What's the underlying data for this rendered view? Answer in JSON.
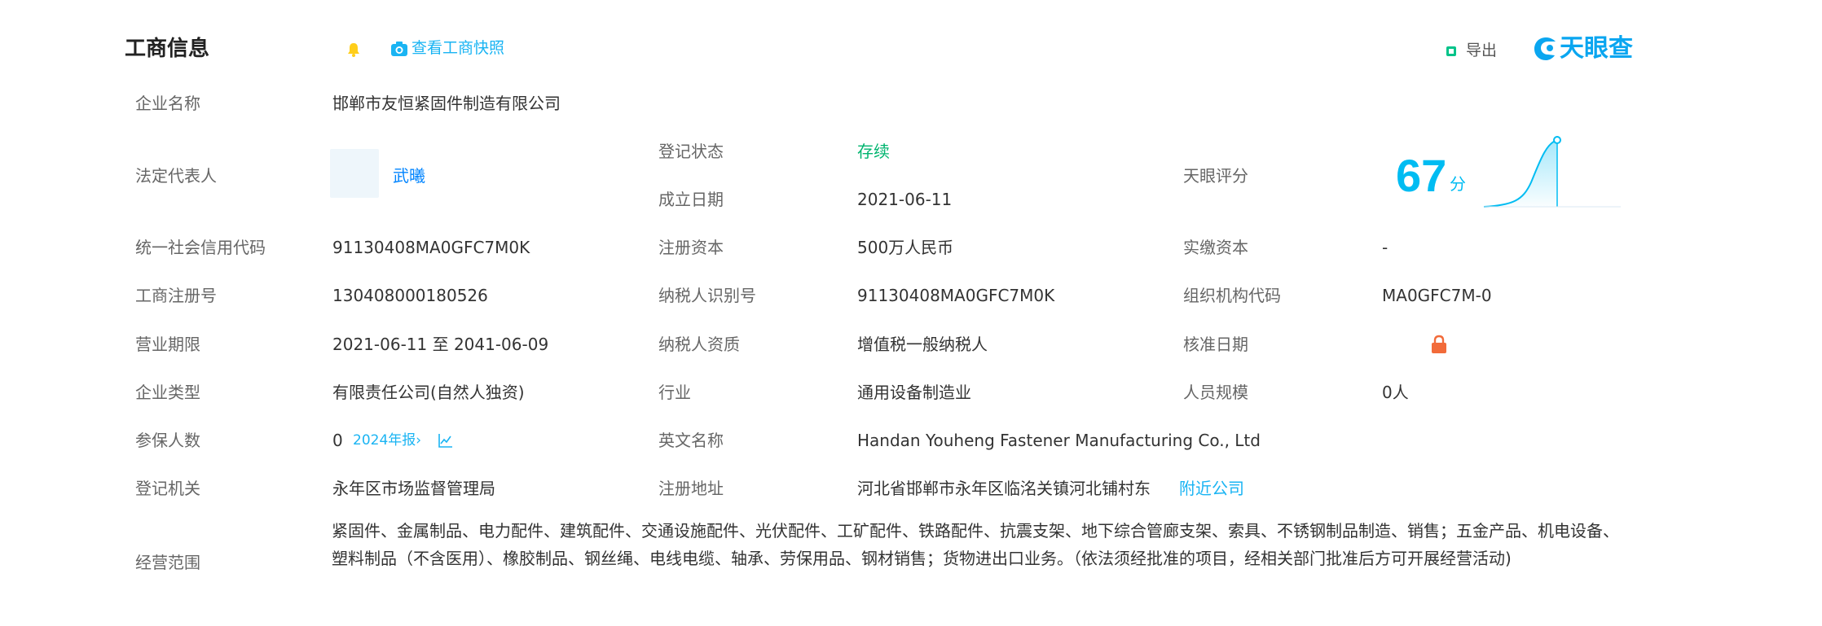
{
  "header": {
    "title": "工商信息",
    "snapshot_link": "查看工商快照",
    "export_label": "导出",
    "brand": "天眼查"
  },
  "rows": {
    "company_name": {
      "label": "企业名称",
      "value": "邯郸市友恒紧固件制造有限公司"
    },
    "legal_rep": {
      "label": "法定代表人",
      "value": "武曦"
    },
    "reg_status": {
      "label": "登记状态",
      "value": "存续"
    },
    "found_date": {
      "label": "成立日期",
      "value": "2021-06-11"
    },
    "tianyan_score": {
      "label": "天眼评分",
      "value": "67",
      "unit": "分"
    },
    "credit_code": {
      "label": "统一社会信用代码",
      "value": "91130408MA0GFC7M0K"
    },
    "reg_capital": {
      "label": "注册资本",
      "value": "500万人民币"
    },
    "paid_capital": {
      "label": "实缴资本",
      "value": "-"
    },
    "biz_reg_no": {
      "label": "工商注册号",
      "value": "130408000180526"
    },
    "taxpayer_id": {
      "label": "纳税人识别号",
      "value": "91130408MA0GFC7M0K"
    },
    "org_code": {
      "label": "组织机构代码",
      "value": "MA0GFC7M-0"
    },
    "biz_term": {
      "label": "营业期限",
      "value": "2021-06-11 至 2041-06-09"
    },
    "taxpayer_qual": {
      "label": "纳税人资质",
      "value": "增值税一般纳税人"
    },
    "approve_date": {
      "label": "核准日期"
    },
    "company_type": {
      "label": "企业类型",
      "value": "有限责任公司(自然人独资)"
    },
    "industry": {
      "label": "行业",
      "value": "通用设备制造业"
    },
    "staff_size": {
      "label": "人员规模",
      "value": "0人"
    },
    "insured": {
      "label": "参保人数",
      "value": "0",
      "report_link": "2024年报›"
    },
    "english_name": {
      "label": "英文名称",
      "value": "Handan Youheng Fastener Manufacturing Co., Ltd"
    },
    "reg_authority": {
      "label": "登记机关",
      "value": "永年区市场监督管理局"
    },
    "reg_address": {
      "label": "注册地址",
      "value": "河北省邯郸市永年区临洺关镇河北铺村东",
      "nearby_link": "附近公司"
    },
    "biz_scope": {
      "label": "经营范围",
      "value": "紧固件、金属制品、电力配件、建筑配件、交通设施配件、光伏配件、工矿配件、铁路配件、抗震支架、地下综合管廊支架、索具、不锈钢制品制造、销售；五金产品、机电设备、塑料制品（不含医用）、橡胶制品、钢丝绳、电线电缆、轴承、劳保用品、钢材销售；货物进出口业务。（依法须经批准的项目，经相关部门批准后方可开展经营活动)"
    }
  },
  "colors": {
    "accent": "#0084ff",
    "status_green": "#00b46f",
    "score": "#00bcf2",
    "lock": "#f26b3a"
  }
}
